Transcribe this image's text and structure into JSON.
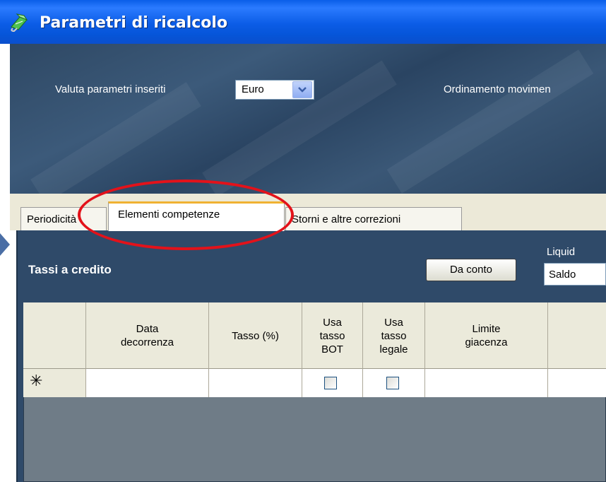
{
  "window": {
    "title": "Parametri di ricalcolo",
    "icon": "gem-clip-icon"
  },
  "header": {
    "valuta_label": "Valuta parametri inseriti",
    "valuta_value": "Euro",
    "ordinamento_label": "Ordinamento movimen"
  },
  "tabs": [
    {
      "label": "Periodicità"
    },
    {
      "label": "Elementi competenze",
      "selected": true
    },
    {
      "label": "Storni e altre correzioni"
    }
  ],
  "content": {
    "section_title": "Tassi a credito",
    "da_conto_button": "Da conto",
    "liquid_label": "Liquid",
    "saldo_value": "Saldo"
  },
  "grid": {
    "columns": [
      {
        "label": ""
      },
      {
        "label": "Data\ndecorrenza"
      },
      {
        "label": "Tasso (%)"
      },
      {
        "label": "Usa\ntasso\nBOT"
      },
      {
        "label": "Usa\ntasso\nlegale"
      },
      {
        "label": "Limite\ngiacenza"
      },
      {
        "label": ""
      }
    ],
    "new_row_marker": "✳"
  },
  "colors": {
    "titlebar": "#0b5ce6",
    "header_panel": "#3c5a7a",
    "content_panel": "#2f4a69",
    "annotation": "#e3121a",
    "selected_tab_accent": "#f0b232"
  }
}
